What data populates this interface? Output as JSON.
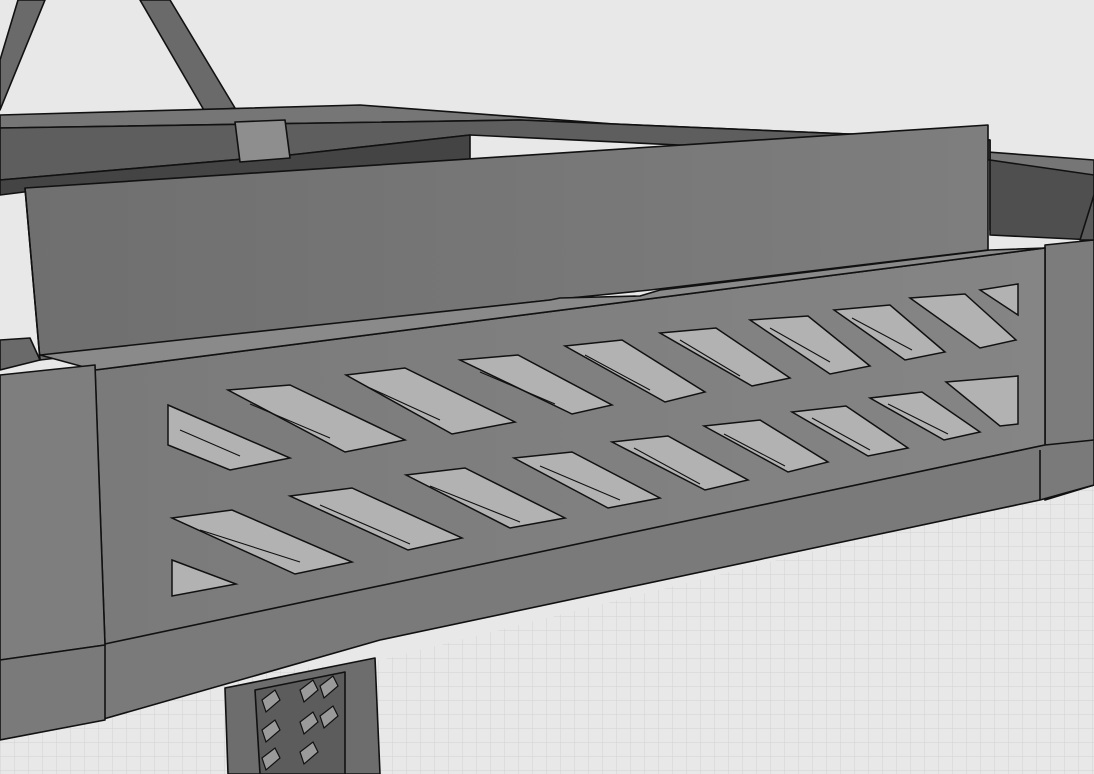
{
  "scene": {
    "kind": "cad-3d-render",
    "subject": "perforated-chassis-side-panel",
    "colors": {
      "background": "#e6e6e6",
      "floor_grid": "#cfcfcf",
      "part_mid": "#7b7b7b",
      "part_light": "#9c9c9c",
      "part_dark": "#5f5f5f",
      "edge": "#111111",
      "slot_interior": "#b4b4b4"
    }
  }
}
